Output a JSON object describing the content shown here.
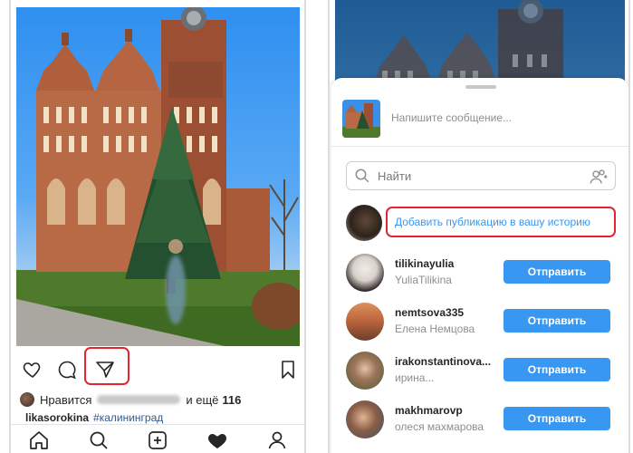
{
  "feed": {
    "likes": {
      "prefix": "Нравится",
      "conjunction": "и ещё",
      "count": "116"
    },
    "caption": {
      "username": "likasorokina",
      "hashtag": "#калининград"
    },
    "icons": {
      "like": "heart-outline-icon",
      "comment": "comment-icon",
      "share": "paper-plane-icon",
      "save": "bookmark-icon"
    },
    "bottom_nav": [
      "home-icon",
      "search-icon",
      "add-post-icon",
      "activity-heart-icon",
      "profile-icon"
    ]
  },
  "share_sheet": {
    "message_placeholder": "Напишите сообщение...",
    "search_placeholder": "Найти",
    "add_to_story": "Добавить публикацию в вашу историю",
    "send_label": "Отправить",
    "accent_color": "#3897f0",
    "highlight_color": "#e0262f",
    "contacts": [
      {
        "username": "tilikinayulia",
        "full_name": "YuliaTilikina"
      },
      {
        "username": "nemtsova335",
        "full_name": "Елена Немцова"
      },
      {
        "username": "irakonstantinova...",
        "full_name": "ирина..."
      },
      {
        "username": "makhmarovp",
        "full_name": "олеся махмарова"
      }
    ]
  }
}
